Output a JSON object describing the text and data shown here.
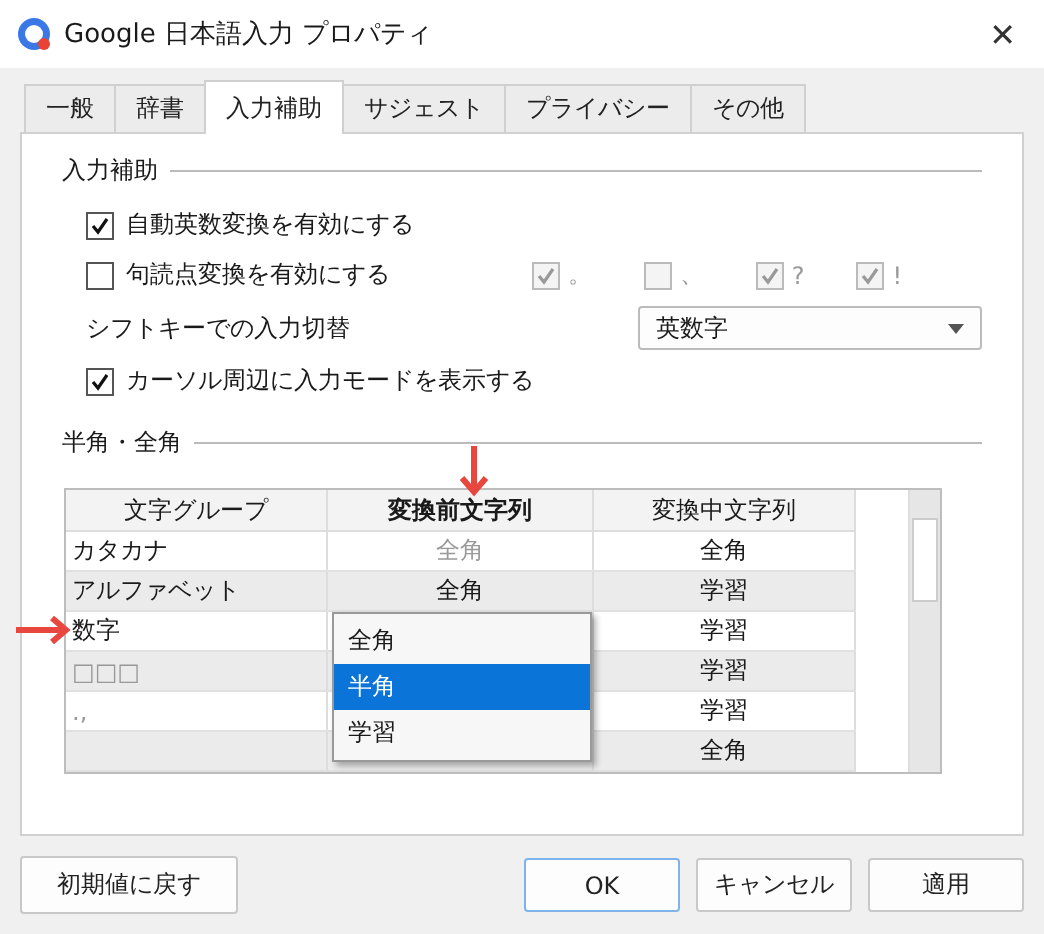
{
  "window": {
    "title": "Google 日本語入力 プロパティ",
    "close": "✕"
  },
  "tabs": [
    {
      "label": "一般",
      "selected": false
    },
    {
      "label": "辞書",
      "selected": false
    },
    {
      "label": "入力補助",
      "selected": true
    },
    {
      "label": "サジェスト",
      "selected": false
    },
    {
      "label": "プライバシー",
      "selected": false
    },
    {
      "label": "その他",
      "selected": false
    }
  ],
  "input_assist": {
    "heading": "入力補助",
    "options": [
      {
        "kind": "checkbox",
        "label": "自動英数変換を有効にする",
        "checked": true
      },
      {
        "kind": "punct",
        "label": "句読点変換を有効にする",
        "checked": false,
        "marks": [
          {
            "label": "。",
            "checked": true
          },
          {
            "label": "、",
            "checked": false
          },
          {
            "label": "?",
            "checked": true
          },
          {
            "label": "!",
            "checked": true
          }
        ]
      },
      {
        "kind": "select",
        "label": "シフトキーでの入力切替",
        "value": "英数字"
      },
      {
        "kind": "checkbox",
        "label": "カーソル周辺に入力モードを表示する",
        "checked": true
      }
    ]
  },
  "width_section": {
    "heading": "半角・全角",
    "table": {
      "columns": [
        "文字グループ",
        "変換前文字列",
        "変換中文字列"
      ],
      "rows": [
        {
          "cells": [
            {
              "text": "カタカナ",
              "disabled": false
            },
            {
              "text": "全角",
              "disabled": true
            },
            {
              "text": "全角",
              "disabled": false
            }
          ]
        },
        {
          "cells": [
            {
              "text": "アルファベット",
              "disabled": false
            },
            {
              "text": "全角",
              "disabled": false
            },
            {
              "text": "学習",
              "disabled": false
            }
          ]
        },
        {
          "cells": [
            {
              "text": "数字",
              "disabled": false
            },
            null,
            {
              "text": "学習",
              "disabled": false
            }
          ]
        },
        {
          "cells": [
            {
              "text": "□□□",
              "disabled": true
            },
            null,
            {
              "text": "学習",
              "disabled": false
            }
          ]
        },
        {
          "cells": [
            {
              "text": ".,",
              "disabled": true
            },
            null,
            {
              "text": "学習",
              "disabled": false
            }
          ]
        },
        {
          "cells": [
            null,
            null,
            {
              "text": "全角",
              "disabled": false
            }
          ]
        }
      ]
    },
    "dropdown": [
      {
        "label": "全角",
        "selected": false
      },
      {
        "label": "半角",
        "selected": true
      },
      {
        "label": "学習",
        "selected": false
      }
    ]
  },
  "buttons": {
    "reset": "初期値に戻す",
    "ok": "OK",
    "cancel": "キャンセル",
    "apply": "適用"
  }
}
